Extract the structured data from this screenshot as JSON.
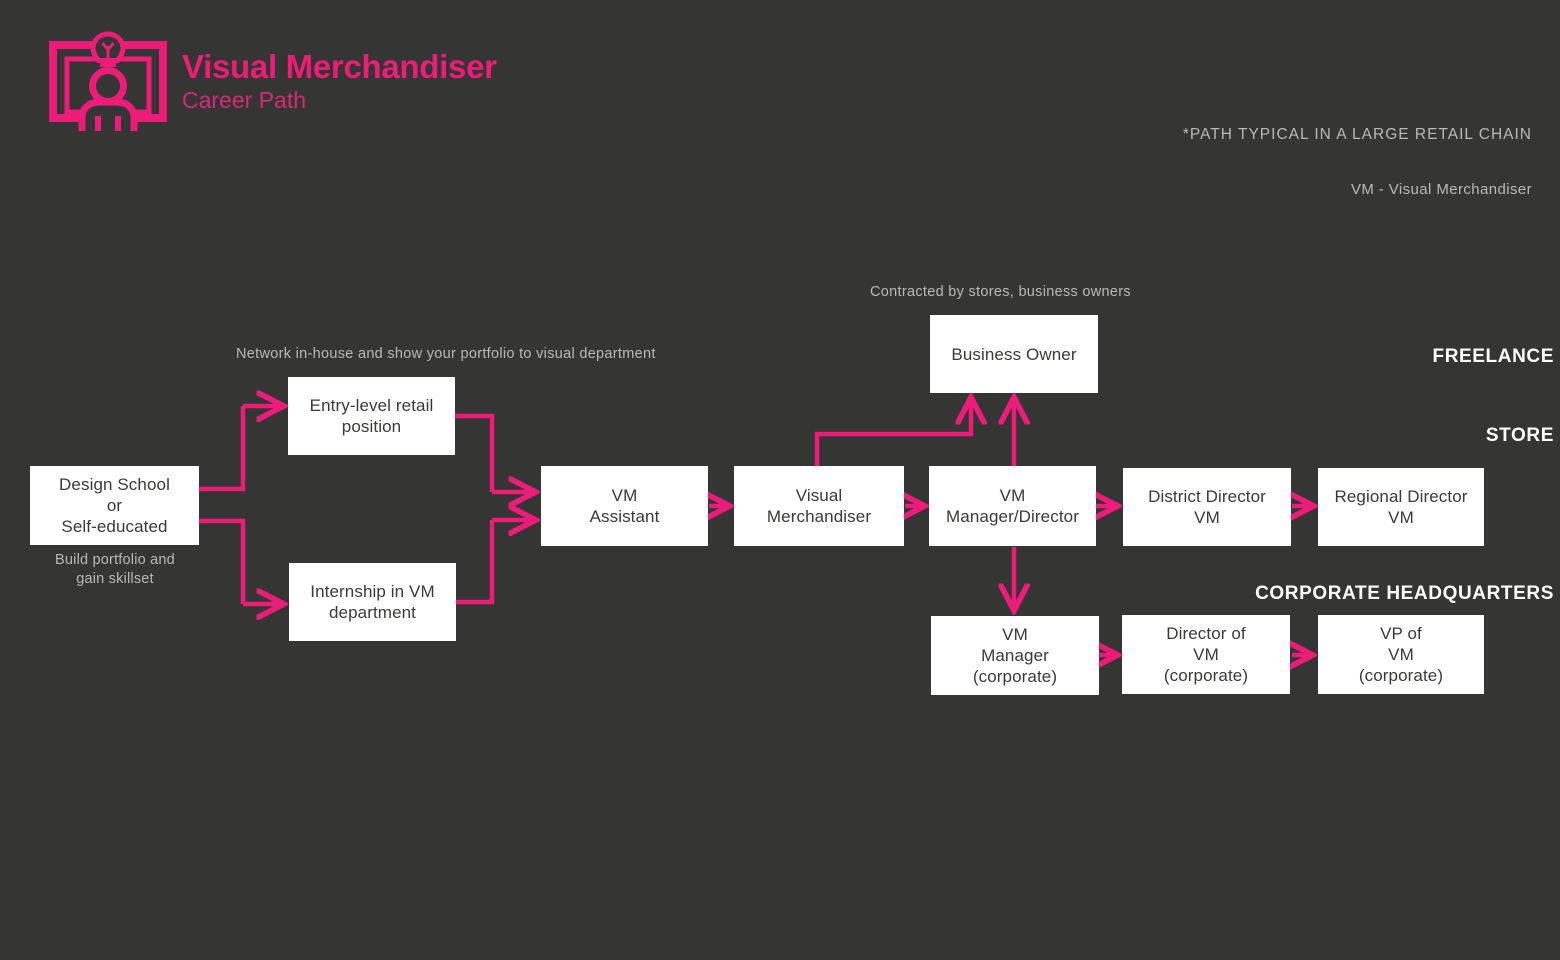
{
  "header": {
    "title": "Visual Merchandiser",
    "subtitle": "Career Path",
    "logo_icon": "storefront-mannequin-lightbulb-icon",
    "brand_color": "#ED1C78",
    "background_color": "#353533"
  },
  "notes": {
    "typical_path": "*PATH TYPICAL IN A LARGE RETAIL CHAIN",
    "abbreviation_legend": "VM - Visual Merchandiser"
  },
  "section_labels": {
    "freelance": "FREELANCE",
    "store": "STORE",
    "corporate": "CORPORATE HEADQUARTERS"
  },
  "annotations": {
    "network": "Network in-house and show your portfolio to visual department",
    "contracted": "Contracted by stores, business owners",
    "build_portfolio": "Build portfolio and\ngain skillset"
  },
  "nodes": {
    "design_school": "Design School\nor\nSelf-educated",
    "entry_level": "Entry-level retail\nposition",
    "internship": "Internship in VM\ndepartment",
    "vm_assistant": "VM\nAssistant",
    "visual_merchandiser": "Visual\nMerchandiser",
    "vm_manager_director": "VM\nManager/Director",
    "district_director": "District Director\nVM",
    "regional_director": "Regional Director\nVM",
    "business_owner": "Business Owner",
    "vm_manager_corporate": "VM\nManager\n(corporate)",
    "director_vm_corporate": "Director of\nVM\n(corporate)",
    "vp_vm_corporate": "VP of\nVM\n(corporate)"
  },
  "flow_edges": [
    {
      "from": "design_school",
      "to": "entry_level"
    },
    {
      "from": "design_school",
      "to": "internship"
    },
    {
      "from": "entry_level",
      "to": "vm_assistant"
    },
    {
      "from": "internship",
      "to": "vm_assistant"
    },
    {
      "from": "vm_assistant",
      "to": "visual_merchandiser"
    },
    {
      "from": "visual_merchandiser",
      "to": "vm_manager_director"
    },
    {
      "from": "visual_merchandiser",
      "to": "business_owner"
    },
    {
      "from": "vm_manager_director",
      "to": "business_owner"
    },
    {
      "from": "vm_manager_director",
      "to": "district_director"
    },
    {
      "from": "district_director",
      "to": "regional_director"
    },
    {
      "from": "vm_manager_director",
      "to": "vm_manager_corporate"
    },
    {
      "from": "vm_manager_corporate",
      "to": "director_vm_corporate"
    },
    {
      "from": "director_vm_corporate",
      "to": "vp_vm_corporate"
    }
  ]
}
